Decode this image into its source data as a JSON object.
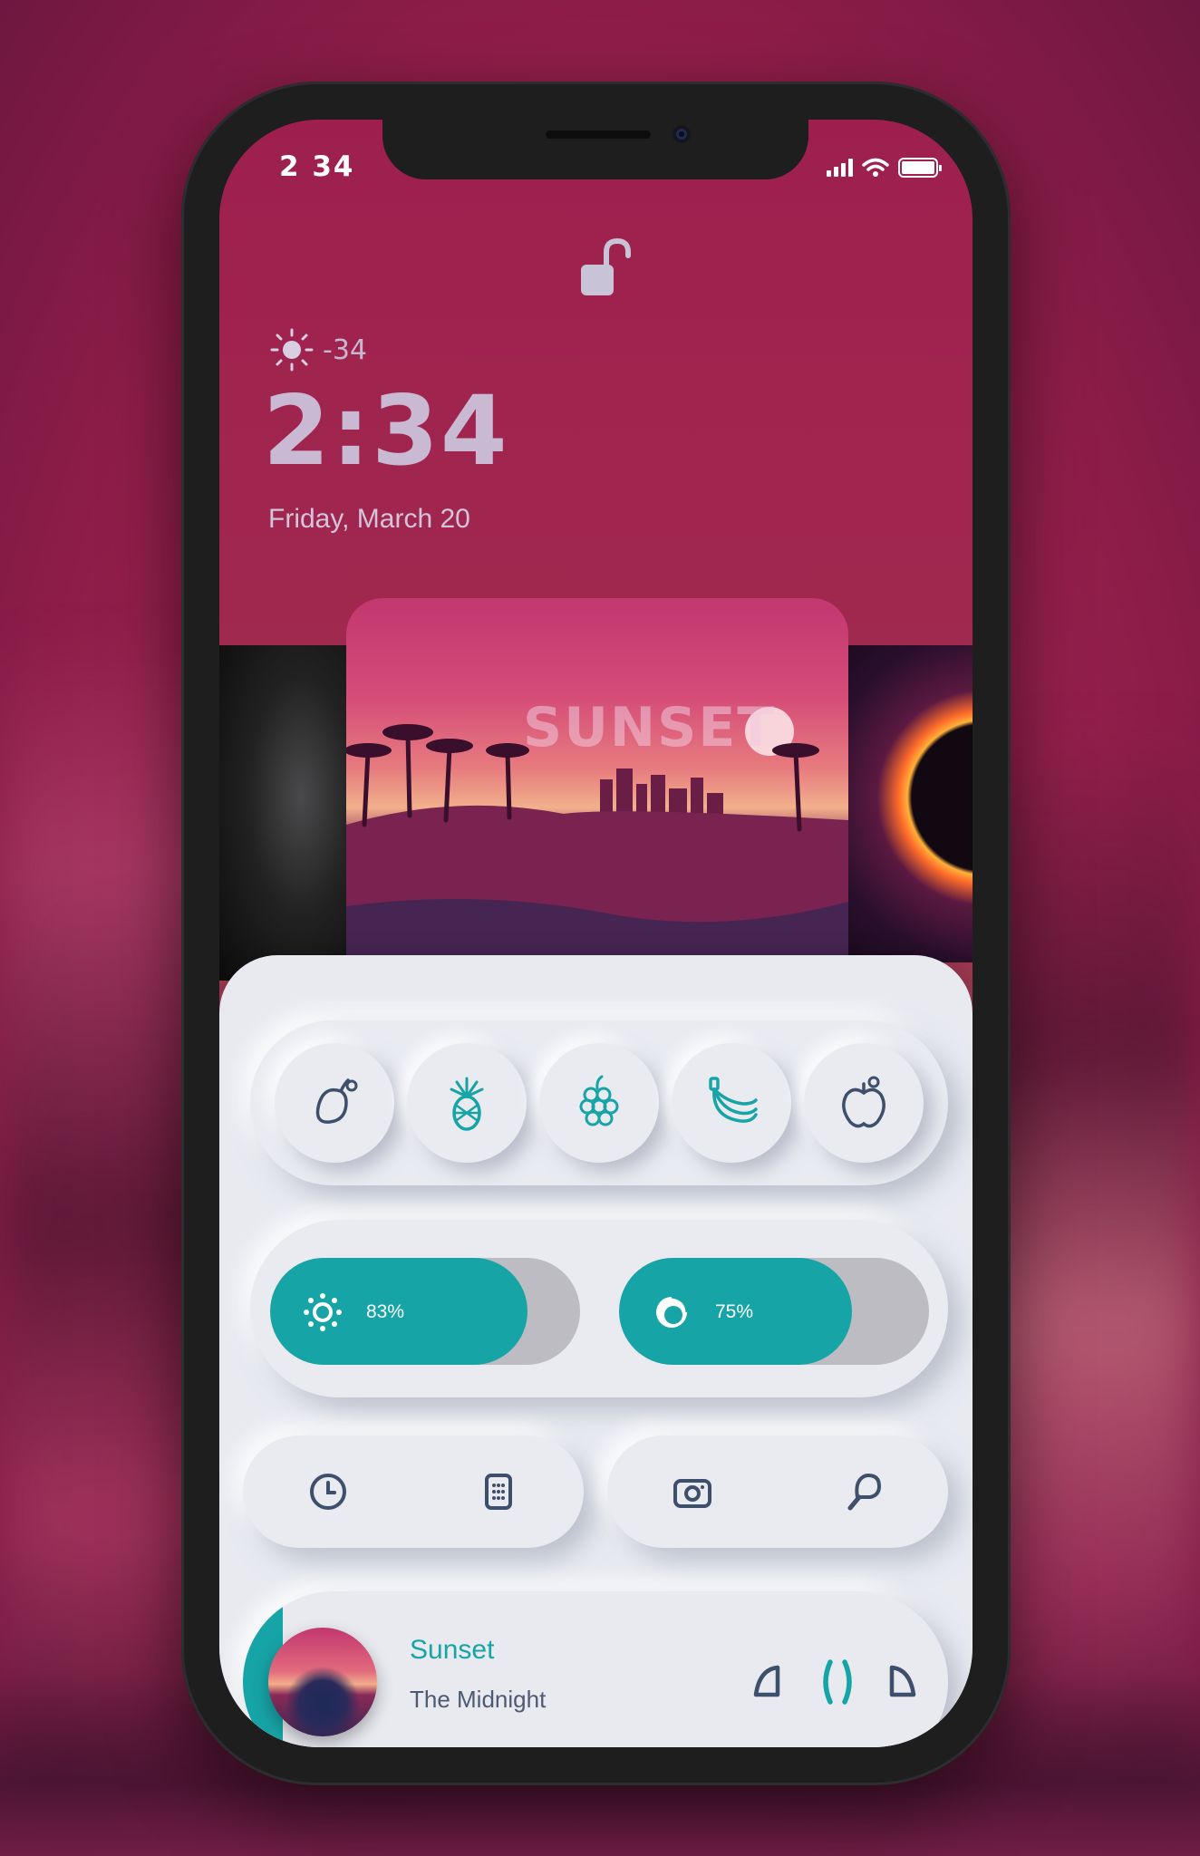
{
  "status_bar": {
    "time": "2 34",
    "icons": [
      "cellular-signal-icon",
      "wifi-icon",
      "battery-icon"
    ]
  },
  "lock_screen": {
    "lock_icon": "unlock-icon",
    "weather_icon": "sun-icon",
    "temperature": "-34",
    "clock": "2:34",
    "date": "Friday, March 20"
  },
  "album_carousel": {
    "center_album_text": "SUNSET"
  },
  "quick_apps": {
    "items": [
      {
        "name": "mango",
        "icon": "mango-icon"
      },
      {
        "name": "pineapple",
        "icon": "pineapple-icon"
      },
      {
        "name": "grapes",
        "icon": "grapes-icon"
      },
      {
        "name": "banana",
        "icon": "banana-icon"
      },
      {
        "name": "apple",
        "icon": "apple-icon"
      }
    ]
  },
  "sliders": {
    "brightness": {
      "icon": "brightness-icon",
      "label": "83%",
      "value": 0.83
    },
    "volume": {
      "icon": "volume-ring-icon",
      "label": "75%",
      "value": 0.75
    }
  },
  "shortcuts": {
    "left": [
      "clock-icon",
      "calculator-icon"
    ],
    "right": [
      "camera-icon",
      "flashlight-icon"
    ]
  },
  "now_playing": {
    "title": "Sunset",
    "artist": "The Midnight",
    "controls": [
      "previous-icon",
      "pause-icon",
      "next-icon"
    ]
  },
  "colors": {
    "accent": "#17a4a6",
    "background": "#a12452",
    "panel": "#e8eaf0",
    "icon_dark": "#3d4f6b"
  }
}
